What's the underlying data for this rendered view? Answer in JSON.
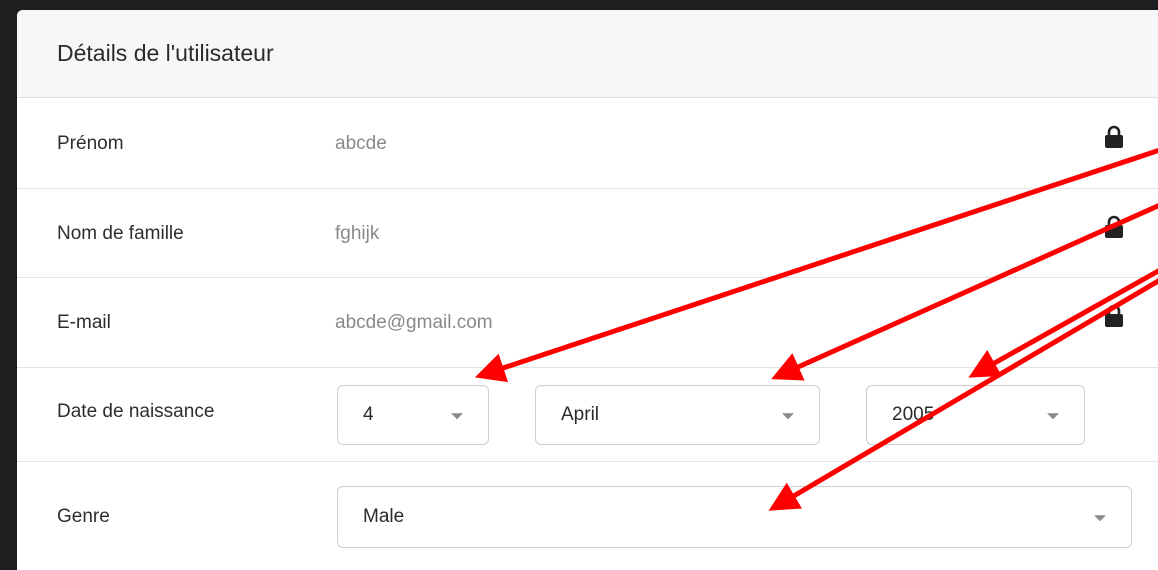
{
  "header": {
    "title": "Détails de l'utilisateur"
  },
  "fields": {
    "first_name": {
      "label": "Prénom",
      "value": "abcde"
    },
    "last_name": {
      "label": "Nom de famille",
      "value": "fghijk"
    },
    "email": {
      "label": "E-mail",
      "value": "abcde@gmail.com"
    },
    "birth_date": {
      "label": "Date de naissance",
      "day": "4",
      "month": "April",
      "year": "2005"
    },
    "gender": {
      "label": "Genre",
      "value": "Male"
    }
  },
  "icons": {
    "lock": "lock-icon",
    "caret": "chevron-down-icon"
  },
  "colors": {
    "annotation_arrow": "#ff0000",
    "background": "#1e1e1e"
  }
}
